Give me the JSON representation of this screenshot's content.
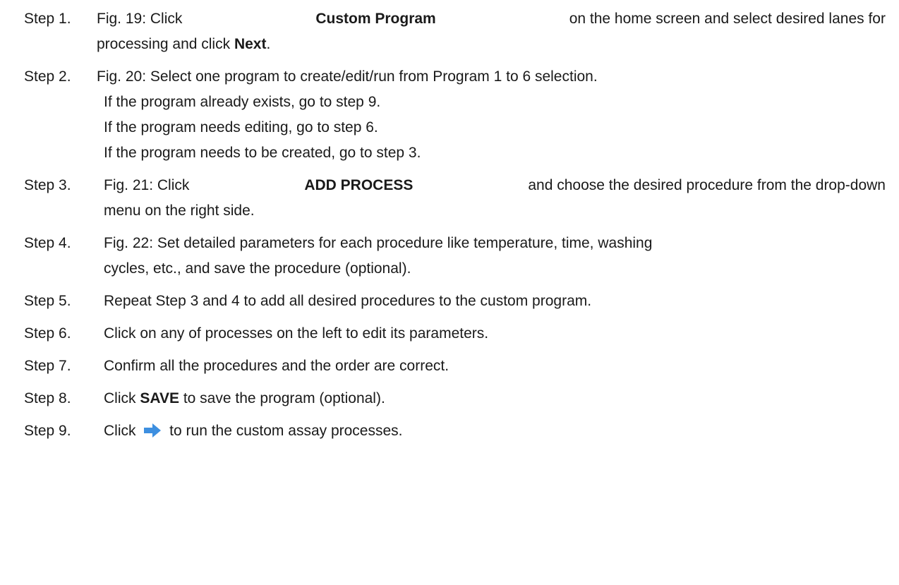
{
  "steps": [
    {
      "label": "Step 1.",
      "lines": [
        {
          "parts": [
            {
              "t": "Fig. 19: Click ",
              "b": false
            },
            {
              "t": "Custom Program",
              "b": true
            },
            {
              "t": " on the home screen and select desired lanes for",
              "b": false
            }
          ]
        },
        {
          "parts": [
            {
              "t": "processing and click ",
              "b": false
            },
            {
              "t": "Next",
              "b": true
            },
            {
              "t": ".",
              "b": false
            }
          ]
        }
      ]
    },
    {
      "label": "Step 2.",
      "lines": [
        {
          "parts": [
            {
              "t": "Fig. 20: Select one program to create/edit/run from Program 1 to 6 selection.",
              "b": false
            }
          ]
        },
        {
          "parts": [
            {
              "t": "If the program already exists, go to step 9.",
              "b": false
            }
          ]
        },
        {
          "parts": [
            {
              "t": "If the program needs editing, go to step 6.",
              "b": false
            }
          ]
        },
        {
          "parts": [
            {
              "t": "If the program needs to be created, go to step 3.",
              "b": false
            }
          ]
        }
      ]
    },
    {
      "label": "Step 3.",
      "lines": [
        {
          "parts": [
            {
              "t": "Fig. 21: Click ",
              "b": false
            },
            {
              "t": "ADD PROCESS",
              "b": true
            },
            {
              "t": " and choose the desired procedure from the drop-down",
              "b": false
            }
          ]
        },
        {
          "parts": [
            {
              "t": "menu on the right side.",
              "b": false
            }
          ]
        }
      ]
    },
    {
      "label": "Step 4.",
      "lines": [
        {
          "parts": [
            {
              "t": "Fig. 22: Set detailed parameters for each procedure like temperature, time, washing",
              "b": false
            }
          ]
        },
        {
          "parts": [
            {
              "t": "cycles, etc., and save the procedure (optional).",
              "b": false
            }
          ]
        }
      ]
    },
    {
      "label": "Step 5.",
      "lines": [
        {
          "parts": [
            {
              "t": "Repeat Step 3 and 4 to add all desired procedures to the custom program.",
              "b": false
            }
          ]
        }
      ]
    },
    {
      "label": "Step 6.",
      "lines": [
        {
          "parts": [
            {
              "t": "Click on any of processes on the left to edit its parameters.",
              "b": false
            }
          ]
        }
      ]
    },
    {
      "label": "Step 7.",
      "lines": [
        {
          "parts": [
            {
              "t": "Confirm all the procedures and the order are correct.",
              "b": false
            }
          ]
        }
      ]
    },
    {
      "label": "Step 8.",
      "lines": [
        {
          "parts": [
            {
              "t": "Click ",
              "b": false
            },
            {
              "t": "SAVE",
              "b": true
            },
            {
              "t": " to save the program (optional).",
              "b": false
            }
          ]
        }
      ]
    },
    {
      "label": "Step 9.",
      "lines": [
        {
          "parts": [
            {
              "t": "Click ",
              "b": false
            },
            {
              "t": "[arrow]",
              "b": false,
              "icon": "right-arrow-icon"
            },
            {
              "t": " to run the custom assay processes.",
              "b": false
            }
          ]
        }
      ]
    }
  ],
  "icon_color": "#3d8fe0"
}
